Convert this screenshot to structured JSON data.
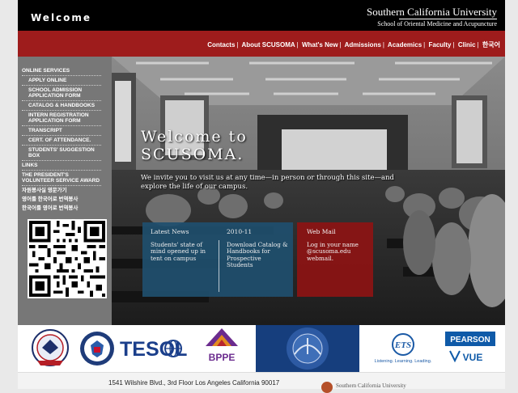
{
  "header": {
    "welcome": "Welcome",
    "brand_name": "Southern California University",
    "brand_sub": "School of Oriental Medicine and Acupuncture"
  },
  "nav": {
    "links": [
      "Contacts",
      "About SCUSOMA",
      "What's New",
      "Admissions",
      "Academics",
      "Faculty",
      "Clinic",
      "한국어"
    ]
  },
  "sidebar": {
    "items": [
      "ONLINE SERVICES",
      "APPLY ONLINE",
      "SCHOOL ADMISSION APPLICATION FORM",
      "CATALOG & HANDBOOKS",
      "INTERN REGISTRATION APPLICATION FORM",
      "TRANSCRIPT",
      "CERT. OF ATTENDANCE.",
      "STUDENTS' SUGGESTION BOX",
      "LINKS",
      "THE PRESIDENT'S VOLUNTEER SERVICE AWARD",
      "자원봉사실 영문가기",
      "영어를 한국어로 번역봉사",
      "한국어를 영어로 번역봉사"
    ]
  },
  "hero": {
    "title_line1": "Welcome to",
    "title_line2": "SCUSOMA.",
    "subtitle": "We invite you to visit us at any time—in person or through this site—and explore the life of our campus."
  },
  "panels": {
    "latest_news": {
      "heading": "Latest News",
      "text": "Students' state of mind opened up in tent on campus"
    },
    "catalog": {
      "heading": "2010-11",
      "text": "Download Catalog & Handbooks for Prospective Students"
    },
    "webmail": {
      "heading": "Web Mail",
      "text": "Log in your name @scusoma.edu webmail."
    }
  },
  "logos": {
    "tesol": "TESOL",
    "bppe": "BPPE",
    "ets": "ETS",
    "ets_tag": "Listening. Learning. Leading.",
    "pearson": "PEARSON",
    "vue": "VUE"
  },
  "footer": {
    "address": "1541 Wilshire Blvd., 3rd Floor Los Angeles California 90017"
  },
  "colors": {
    "nav_red": "#9e1c1c",
    "panel_blue": "#1f4f6e",
    "panel_red": "#8a1414",
    "sidebar_gray": "#777777"
  }
}
